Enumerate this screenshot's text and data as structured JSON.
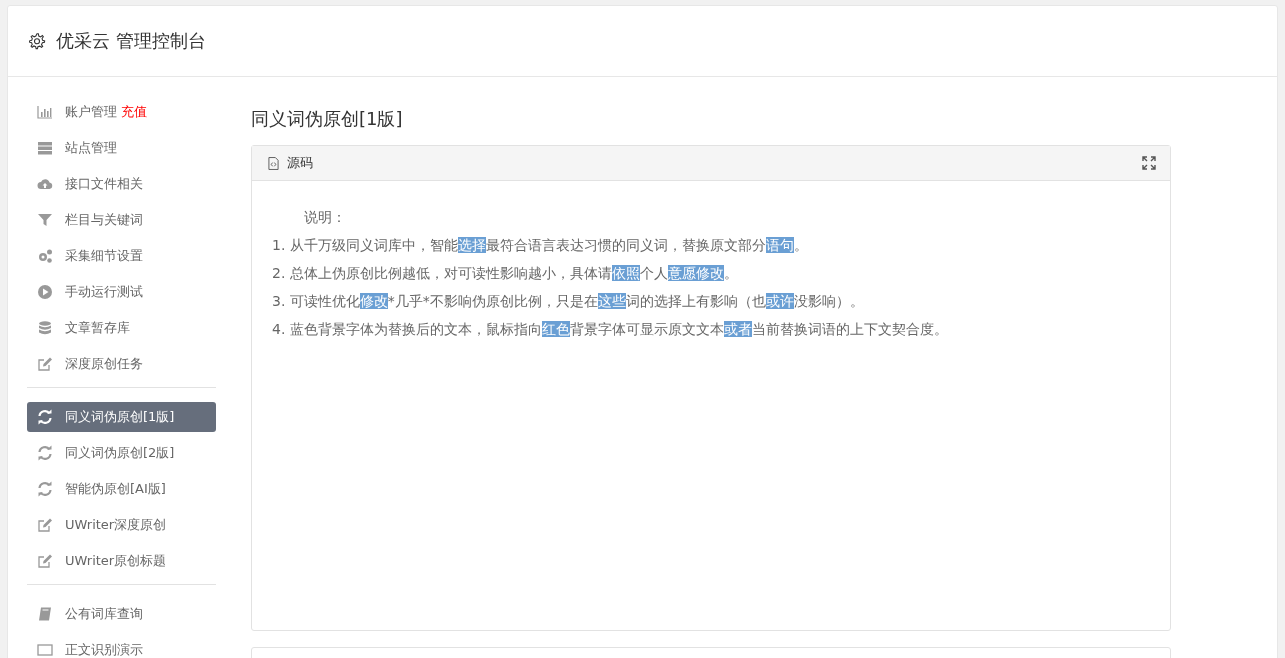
{
  "header": {
    "title": "优采云 管理控制台"
  },
  "sidebar": {
    "groups": [
      {
        "items": [
          {
            "label": "账户管理",
            "badge": "充值",
            "selected": false
          },
          {
            "label": "站点管理",
            "selected": false
          },
          {
            "label": "接口文件相关",
            "selected": false
          },
          {
            "label": "栏目与关键词",
            "selected": false
          },
          {
            "label": "采集细节设置",
            "selected": false
          },
          {
            "label": "手动运行测试",
            "selected": false
          },
          {
            "label": "文章暂存库",
            "selected": false
          },
          {
            "label": "深度原创任务",
            "selected": false
          }
        ]
      },
      {
        "items": [
          {
            "label": "同义词伪原创[1版]",
            "selected": true
          },
          {
            "label": "同义词伪原创[2版]",
            "selected": false
          },
          {
            "label": "智能伪原创[AI版]",
            "selected": false
          },
          {
            "label": "UWriter深度原创",
            "selected": false
          },
          {
            "label": "UWriter原创标题",
            "selected": false
          }
        ]
      },
      {
        "items": [
          {
            "label": "公有词库查询",
            "selected": false
          },
          {
            "label": "正文识别演示",
            "selected": false
          }
        ]
      }
    ]
  },
  "main": {
    "title": "同义词伪原创[1版]",
    "panel": {
      "title": "源码",
      "heading": "说明：",
      "lines": [
        [
          {
            "text": "1. 从千万级同义词库中，智能",
            "highlight": false
          },
          {
            "text": "选择",
            "highlight": true
          },
          {
            "text": "最符合语言表达习惯的同义词，替换原文部分",
            "highlight": false
          },
          {
            "text": "语句",
            "highlight": true
          },
          {
            "text": "。",
            "highlight": false
          }
        ],
        [
          {
            "text": "2. 总体上伪原创比例越低，对可读性影响越小，具体请",
            "highlight": false
          },
          {
            "text": "依照",
            "highlight": true
          },
          {
            "text": "个人",
            "highlight": false
          },
          {
            "text": "意愿",
            "highlight": true
          },
          {
            "text": "修改",
            "highlight": true
          },
          {
            "text": "。",
            "highlight": false
          }
        ],
        [
          {
            "text": "3. 可读性优化",
            "highlight": false
          },
          {
            "text": "修改",
            "highlight": true
          },
          {
            "text": "*几乎*不影响伪原创比例，只是在",
            "highlight": false
          },
          {
            "text": "这些",
            "highlight": true
          },
          {
            "text": "词的选择上有影响（也",
            "highlight": false
          },
          {
            "text": "或许",
            "highlight": true
          },
          {
            "text": "没影响）。",
            "highlight": false
          }
        ],
        [
          {
            "text": "4. 蓝色背景字体为替换后的文本，鼠标指向",
            "highlight": false
          },
          {
            "text": "红色",
            "highlight": true
          },
          {
            "text": "背景字体可显示原文文本",
            "highlight": false
          },
          {
            "text": "或者",
            "highlight": true
          },
          {
            "text": "当前替换词语的上下文契合度。",
            "highlight": false
          }
        ]
      ]
    }
  }
}
